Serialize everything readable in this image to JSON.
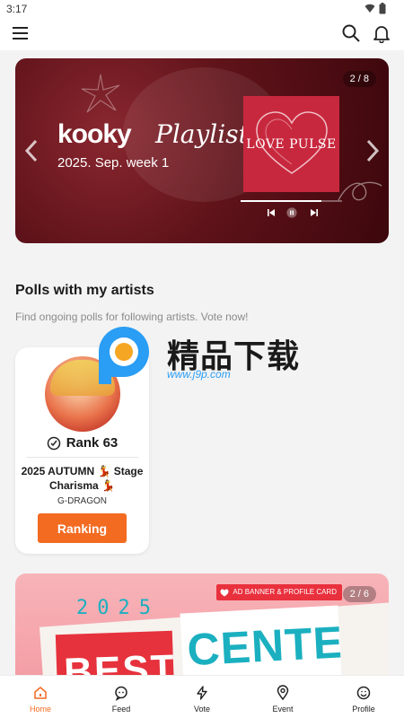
{
  "status_bar": {
    "time": "3:17"
  },
  "colors": {
    "accent": "#f36a21",
    "banner_red": "#5e1219",
    "teal": "#1bb0c0"
  },
  "app_bar": {
    "icons": [
      "menu-icon",
      "search-icon",
      "bell-icon"
    ]
  },
  "banner_top": {
    "brand": "kooky",
    "brand_script": "Playlist",
    "subtitle": "2025. Sep. week 1",
    "album_title": "LOVE PULSE",
    "counter": "2 / 8",
    "playback_progress": 0.8
  },
  "polls": {
    "title": "Polls with my artists",
    "subtitle": "Find ongoing polls for following artists. Vote now!",
    "card": {
      "rank": "Rank 63",
      "poll_name": "2025 AUTUMN 💃 Stage Charisma 💃",
      "artist": "G-DRAGON",
      "button": "Ranking"
    }
  },
  "watermark": {
    "text": "精品下载",
    "url": "www.j9p.com"
  },
  "banner_bottom": {
    "tag": "AD BANNER & PROFILE CARD",
    "counter": "2 / 6",
    "year": "2025",
    "word_left": "BEST",
    "word_right": "CENTER"
  },
  "bottom_nav": {
    "items": [
      {
        "label": "Home",
        "icon": "home-icon",
        "active": true
      },
      {
        "label": "Feed",
        "icon": "feed-icon",
        "active": false
      },
      {
        "label": "Vote",
        "icon": "vote-icon",
        "active": false
      },
      {
        "label": "Event",
        "icon": "event-icon",
        "active": false
      },
      {
        "label": "Profile",
        "icon": "profile-icon",
        "active": false
      }
    ]
  }
}
